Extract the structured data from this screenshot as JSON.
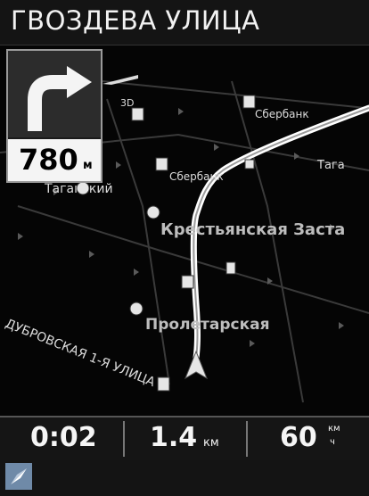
{
  "street": {
    "name": "ГВОЗДЕВА УЛИЦА"
  },
  "turn": {
    "distance": "780",
    "unit": "м",
    "direction": "right"
  },
  "map": {
    "labels": {
      "sberbank1": "Сбербанк",
      "sberbank2": "Сбербанк",
      "tagansk": "Тага",
      "taganskiy": "Таганский",
      "krestyanskaya": "Крестьянская Заста",
      "proletarskaya": "Пролетарская",
      "dubrovskaya": "ДУБРОВСКАЯ 1-Я УЛИЦА",
      "threeD": "3D"
    },
    "colors": {
      "route": "#ffffff",
      "background": "#050505",
      "poi": "#e6e6e6"
    }
  },
  "bottom": {
    "time": "0:02",
    "distance": "1.4",
    "distance_unit": "км",
    "speed": "60",
    "speed_unit_top": "км",
    "speed_unit_bottom": "ч"
  },
  "icons": {
    "turn": "turn-right-arrow-icon",
    "compass": "compass-icon",
    "metro": "metro-icon",
    "bank": "bank-icon",
    "position": "current-position-arrow-icon"
  }
}
